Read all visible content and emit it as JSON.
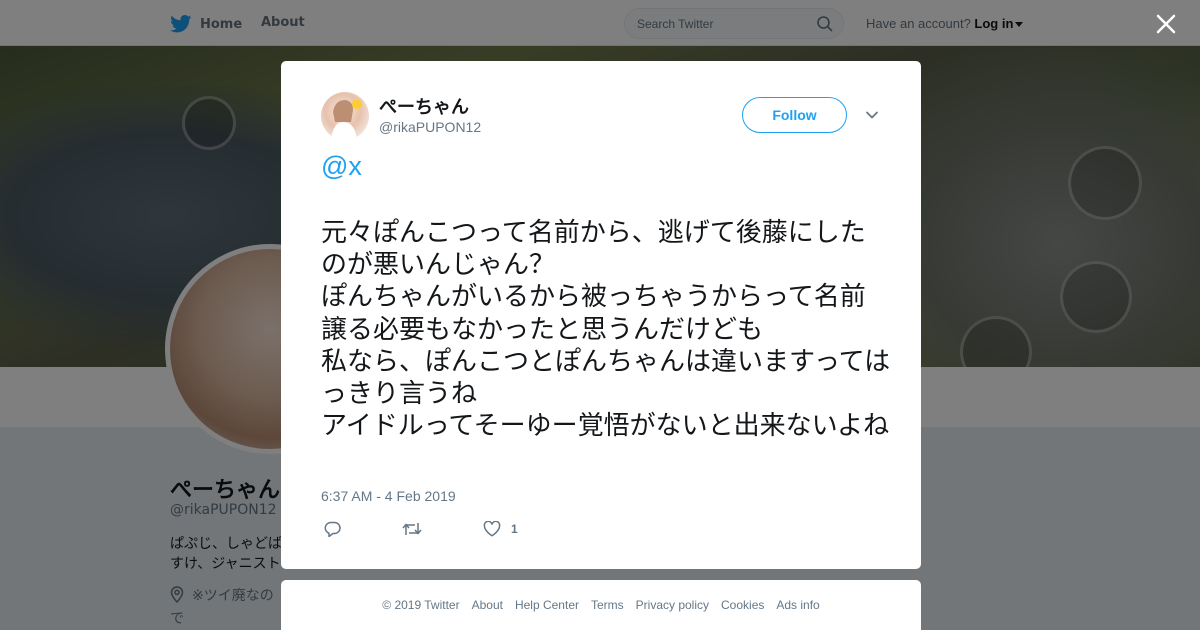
{
  "nav": {
    "home": "Home",
    "about": "About",
    "search_placeholder": "Search Twitter",
    "have_account": "Have an account?",
    "login": "Log in"
  },
  "profile": {
    "name": "ぺーちゃん",
    "handle": "@rikaPUPON12",
    "bio": "ぱぷじ、しゃどば\nすけ、ジャニスト",
    "note": "※ツイ廃なので\nと⚠️⚠️"
  },
  "tweet": {
    "author_name": "ぺーちゃん",
    "author_handle": "@rikaPUPON12",
    "follow_label": "Follow",
    "mention": "@x",
    "text": "元々ぽんこつって名前から、逃げて後藤にしたのが悪いんじゃん？\nぽんちゃんがいるから被っちゃうからって名前譲る必要もなかったと思うんだけども\n私なら、ぽんこつとぽんちゃんは違いますってはっきり言うね\nアイドルってそーゆー覚悟がないと出来ないよね",
    "timestamp": "6:37 AM - 4 Feb 2019",
    "like_count": "1",
    "actions": {
      "reply_icon": "reply-icon",
      "retweet_icon": "retweet-icon",
      "like_icon": "heart-icon"
    }
  },
  "footer": {
    "copyright": "© 2019 Twitter",
    "links": [
      "About",
      "Help Center",
      "Terms",
      "Privacy policy",
      "Cookies",
      "Ads info"
    ]
  },
  "colors": {
    "brand_blue": "#1da1f2",
    "overlay": "rgba(0,0,0,0.5)",
    "muted_text": "#657786"
  }
}
